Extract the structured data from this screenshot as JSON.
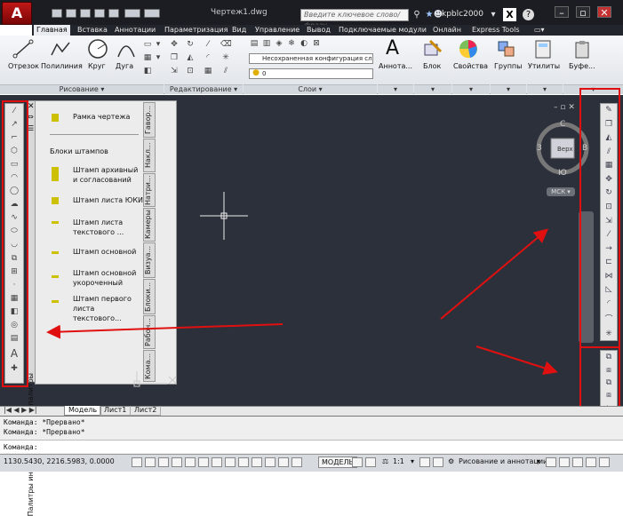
{
  "title_bar": {
    "app_letter": "A",
    "document_title": "Чертеж1.dwg",
    "search_placeholder": "Введите ключевое слово/фразу",
    "user": "kpblc2000",
    "x_label": "X",
    "help": "?"
  },
  "tabs": [
    "Главная",
    "Вставка",
    "Аннотации",
    "Параметризация",
    "Вид",
    "Управление",
    "Вывод",
    "Подключаемые модули",
    "Онлайн",
    "Express Tools"
  ],
  "ribbon": {
    "draw": {
      "title": "Рисование",
      "tools": [
        "Отрезок",
        "Полилиния",
        "Круг",
        "Дуга"
      ]
    },
    "modify": {
      "title": "Редактирование"
    },
    "layers": {
      "title": "Слои",
      "config": "Несохраненная конфигурация сло",
      "layer": "0"
    },
    "annotation": "Аннота...",
    "block": "Блок",
    "properties": "Свойства",
    "groups": "Группы",
    "utilities": "Утилиты",
    "clipboard": "Буфе..."
  },
  "palette": {
    "title": "Палитры инструментов - Все палитры",
    "items": [
      {
        "label": "Рамка чертежа",
        "section": false
      },
      {
        "label": "Блоки штампов",
        "section": true
      },
      {
        "label": "Штамп архивный и согласований",
        "section": false
      },
      {
        "label": "Штамп листа ЮКИ",
        "section": false
      },
      {
        "label": "Штамп листа текстового ...",
        "section": false
      },
      {
        "label": "Штамп основной",
        "section": false
      },
      {
        "label": "Штамп основной укороченный",
        "section": false
      },
      {
        "label": "Штамп первого листа текстового...",
        "section": false
      }
    ],
    "side_tabs": [
      "Гавор...",
      "Накл...",
      "Натри...",
      "Камеры",
      "Визуа...",
      "Блоки...",
      "Рабоч...",
      "Кома..."
    ]
  },
  "viewcube": {
    "north": "С",
    "south": "Ю",
    "west": "З",
    "east": "В",
    "face": "Верх",
    "ucs": "МСК"
  },
  "layout_tabs": [
    "Модель",
    "Лист1",
    "Лист2"
  ],
  "command": {
    "line1": "Команда:  *Прервано*",
    "line2": "Команда:  *Прервано*",
    "prompt": "Команда:"
  },
  "status": {
    "coords": "1130.5430, 2216.5983, 0.0000",
    "model": "МОДЕЛЬ",
    "scale": "1:1",
    "workspace": "Рисование и аннотации"
  },
  "colors": {
    "canvas": "#2b303b",
    "accent_red": "#e01010",
    "titlebar": "#1b1d22"
  }
}
